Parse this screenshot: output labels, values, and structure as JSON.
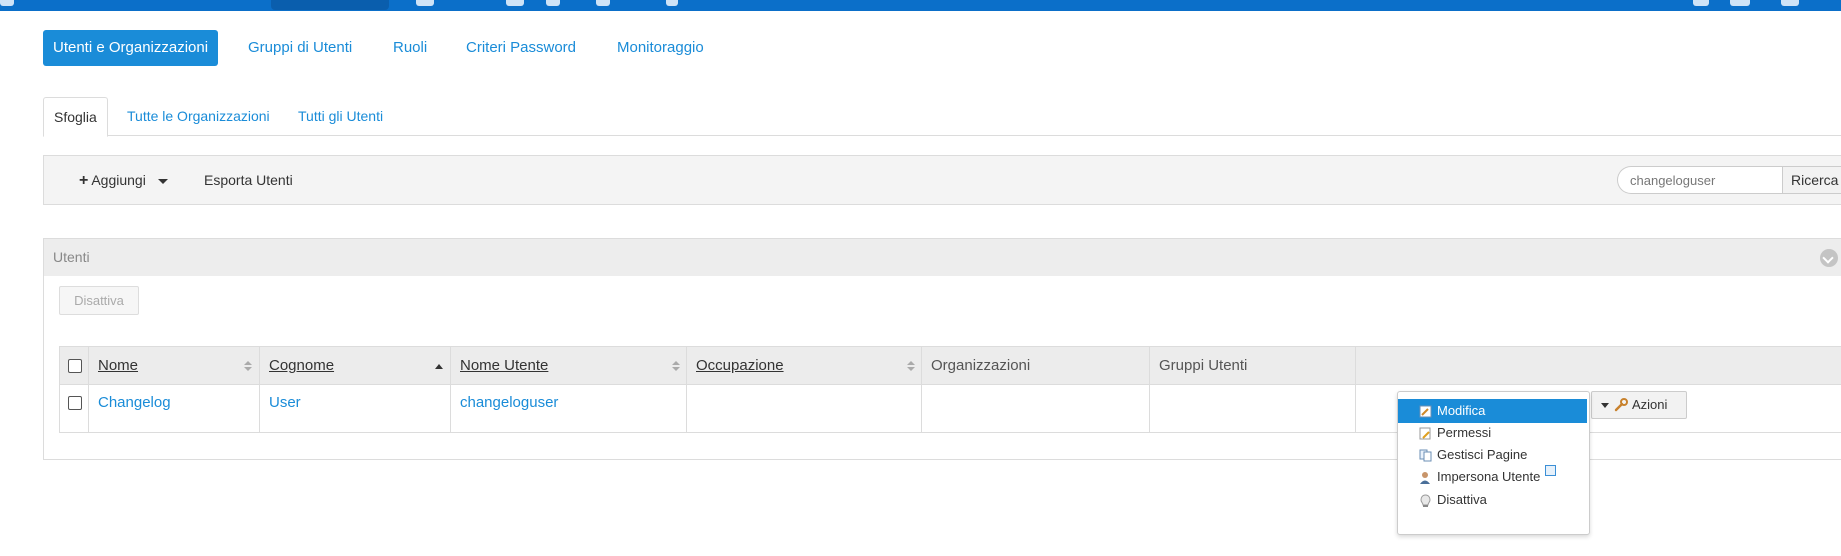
{
  "colors": {
    "accent": "#1a8cd8",
    "topbar": "#0b6fc9"
  },
  "main_nav": [
    {
      "label": "Utenti e Organizzazioni",
      "active": true
    },
    {
      "label": "Gruppi di Utenti"
    },
    {
      "label": "Ruoli"
    },
    {
      "label": "Criteri Password"
    },
    {
      "label": "Monitoraggio"
    }
  ],
  "sub_tabs": [
    {
      "label": "Sfoglia",
      "active": true
    },
    {
      "label": "Tutte le Organizzazioni"
    },
    {
      "label": "Tutti gli Utenti"
    }
  ],
  "toolbar": {
    "add_label": "Aggiungi",
    "export_label": "Esporta Utenti",
    "search_value": "changeloguser",
    "search_button": "Ricerca"
  },
  "panel": {
    "title": "Utenti",
    "deactivate_label": "Disattiva"
  },
  "table": {
    "columns": [
      "Nome",
      "Cognome",
      "Nome Utente",
      "Occupazione",
      "Organizzazioni",
      "Gruppi Utenti"
    ],
    "rows": [
      {
        "nome": "Changelog",
        "cognome": "User",
        "nome_utente": "changeloguser",
        "occupazione": "",
        "organizzazioni": "",
        "gruppi_utenti": ""
      }
    ],
    "sort_column": "Cognome",
    "sort_direction": "ascending"
  },
  "actions_button": "Azioni",
  "actions_menu": [
    {
      "label": "Modifica",
      "icon": "edit-icon",
      "active": true
    },
    {
      "label": "Permessi",
      "icon": "permissions-icon"
    },
    {
      "label": "Gestisci Pagine",
      "icon": "pages-icon"
    },
    {
      "label": "Impersona Utente",
      "icon": "impersonate-icon",
      "external": true
    },
    {
      "label": "Disattiva",
      "icon": "deactivate-icon"
    }
  ]
}
